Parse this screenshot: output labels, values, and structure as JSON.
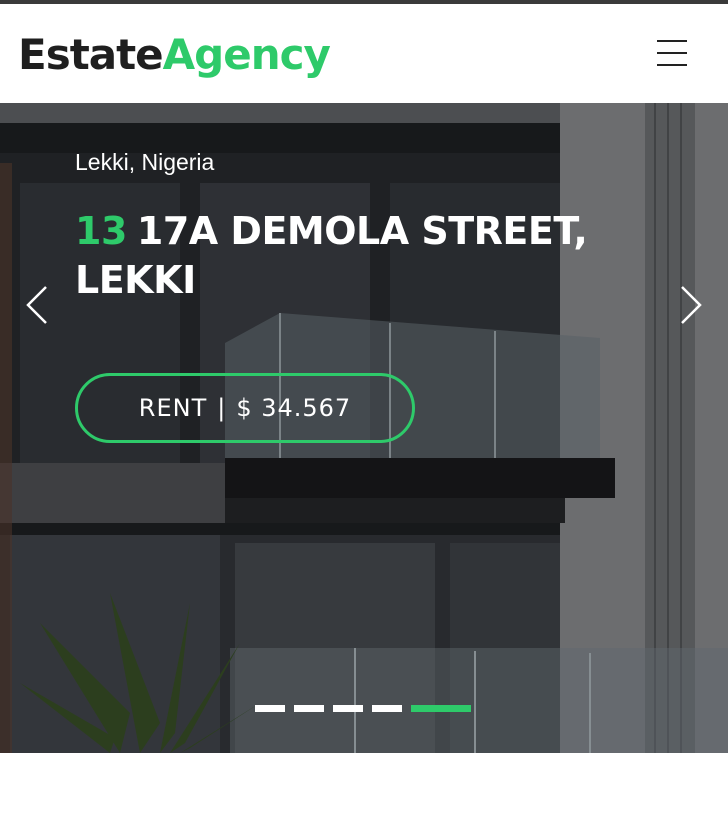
{
  "brand": {
    "part1": "Estate",
    "part2": "Agency"
  },
  "nav": {
    "menu_icon": "hamburger-menu-icon"
  },
  "hero": {
    "location": "Lekki, Nigeria",
    "number": "13",
    "street_line": "17A DEMOLA STREET, LEKKI",
    "rent_label": "RENT",
    "separator": "|",
    "price": "$ 34.567",
    "prev_icon": "chevron-left-icon",
    "next_icon": "chevron-right-icon",
    "slides_total": 5,
    "active_slide": 5
  },
  "colors": {
    "accent": "#2eca6a",
    "text_dark": "#1f1f1f",
    "white": "#ffffff"
  }
}
